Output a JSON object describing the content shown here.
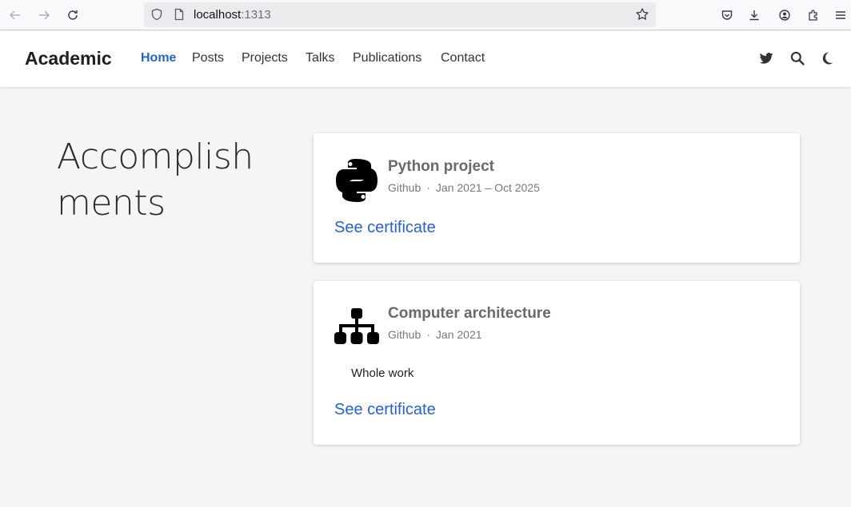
{
  "browser": {
    "url_host": "localhost",
    "url_port": ":1313"
  },
  "nav": {
    "brand": "Academic",
    "items": [
      {
        "label": "Home",
        "active": true
      },
      {
        "label": "Posts"
      },
      {
        "label": "Projects"
      },
      {
        "label": "Talks"
      },
      {
        "label": "Publications"
      },
      {
        "label": "Contact"
      }
    ],
    "icons": [
      "twitter-icon",
      "search-icon",
      "moon-icon"
    ]
  },
  "section": {
    "title": "Accomplishments"
  },
  "accomplishments": [
    {
      "icon": "python-icon",
      "title": "Python project",
      "organization": "Github",
      "date": "Jan 2021 – Oct 2025",
      "link": "See certificate"
    },
    {
      "icon": "sitemap-icon",
      "title": "Computer architecture",
      "organization": "Github",
      "date": "Jan 2021",
      "description": "Whole work",
      "link": "See certificate"
    }
  ],
  "colors": {
    "accent": "#2962c9",
    "page_bg": "#f5f5f5"
  }
}
